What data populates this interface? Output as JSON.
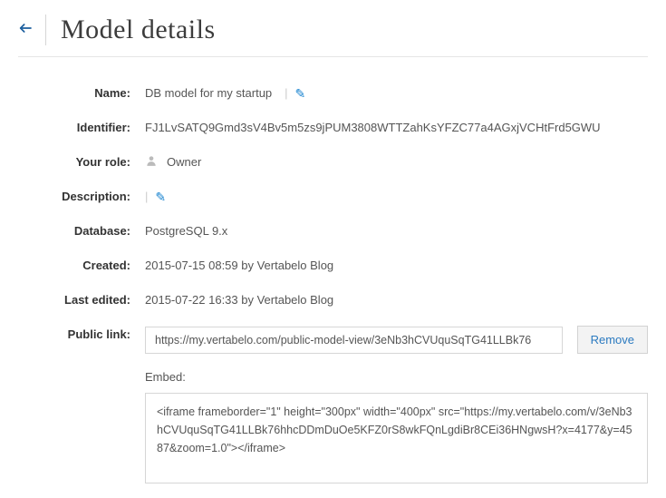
{
  "header": {
    "title": "Model details"
  },
  "fields": {
    "name": {
      "label": "Name:",
      "value": "DB model for my startup"
    },
    "identifier": {
      "label": "Identifier:",
      "value": "FJ1LvSATQ9Gmd3sV4Bv5m5zs9jPUM3808WTTZahKsYFZC77a4AGxjVCHtFrd5GWU"
    },
    "role": {
      "label": "Your role:",
      "value": "Owner"
    },
    "description": {
      "label": "Description:",
      "value": ""
    },
    "database": {
      "label": "Database:",
      "value": "PostgreSQL 9.x"
    },
    "created": {
      "label": "Created:",
      "value": "2015-07-15 08:59 by Vertabelo Blog"
    },
    "last_edited": {
      "label": "Last edited:",
      "value": "2015-07-22 16:33 by Vertabelo Blog"
    },
    "public_link": {
      "label": "Public link:",
      "url": "https://my.vertabelo.com/public-model-view/3eNb3hCVUquSqTG41LLBk76",
      "remove": "Remove"
    },
    "embed": {
      "label": "Embed:",
      "code": "<iframe frameborder=\"1\" height=\"300px\" width=\"400px\" src=\"https://my.vertabelo.com/v/3eNb3hCVUquSqTG41LLBk76hhcDDmDuOe5KFZ0rS8wkFQnLgdiBr8CEi36HNgwsH?x=4177&y=4587&zoom=1.0\"></iframe>"
    }
  }
}
